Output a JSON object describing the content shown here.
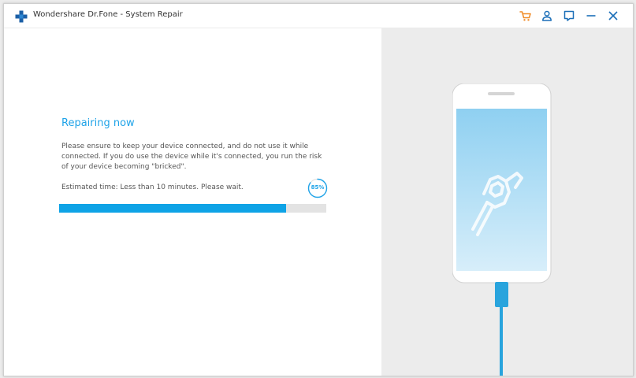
{
  "window": {
    "title": "Wondershare Dr.Fone - System Repair"
  },
  "titlebar": {
    "icons": [
      "cart-icon",
      "account-icon",
      "feedback-icon",
      "minimize-icon",
      "close-icon"
    ]
  },
  "repair": {
    "heading": "Repairing now",
    "description": "Please ensure to keep your device connected, and do not use it while connected. If you do use the device while it's connected, you run the risk of your device becoming \"bricked\".",
    "estimate": "Estimated time: Less than 10 minutes. Please wait.",
    "progress_percent": 85,
    "progress_label": "85%"
  },
  "colors": {
    "accent": "#1fa3e8",
    "progress_fill": "#0ea3e6",
    "progress_track": "#e3e3e3",
    "cart_orange": "#f08a24",
    "icon_blue": "#1b6fb8",
    "screen_top": "#8fd0f1",
    "screen_bottom": "#d7eefa",
    "cable": "#29a4dd"
  }
}
